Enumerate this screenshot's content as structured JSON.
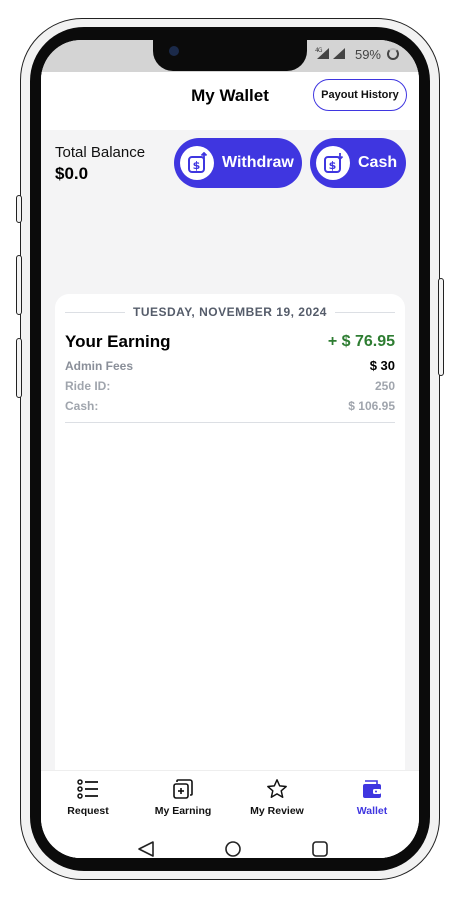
{
  "status_bar": {
    "network": "4G",
    "battery": "59%"
  },
  "header": {
    "title": "My Wallet",
    "payout_history_label": "Payout History"
  },
  "balance": {
    "label": "Total Balance",
    "value": "$0.0",
    "withdraw_label": "Withdraw",
    "cash_label": "Cash"
  },
  "transactions": [
    {
      "date": "TUESDAY, NOVEMBER 19, 2024",
      "earning_label": "Your Earning",
      "earning_value": "+ $ 76.95",
      "admin_fees_label": "Admin Fees",
      "admin_fees_value": "$ 30",
      "ride_id_label": "Ride ID:",
      "ride_id_value": "250",
      "cash_label": "Cash:",
      "cash_value": "$ 106.95"
    }
  ],
  "tabs": [
    {
      "label": "Request",
      "icon": "list-icon"
    },
    {
      "label": "My Earning",
      "icon": "earning-cards-icon"
    },
    {
      "label": "My Review",
      "icon": "star-icon"
    },
    {
      "label": "Wallet",
      "icon": "wallet-icon",
      "active": true
    }
  ],
  "colors": {
    "accent": "#3f36e0",
    "earning_green": "#2e7d32"
  }
}
